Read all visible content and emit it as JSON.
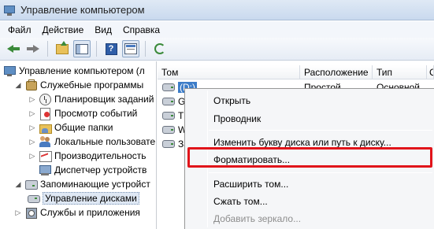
{
  "window": {
    "title": "Управление компьютером"
  },
  "menubar": {
    "items": [
      "Файл",
      "Действие",
      "Вид",
      "Справка"
    ]
  },
  "toolbar": {
    "buttons": [
      "back-icon",
      "forward-icon",
      "up-folder-icon",
      "show-hide-tree-icon",
      "help-icon",
      "properties-icon",
      "refresh-icon"
    ],
    "help_glyph": "?"
  },
  "tree": {
    "root": "Управление компьютером (л",
    "system_tools": "Служебные программы",
    "task_scheduler": "Планировщик заданий",
    "event_viewer": "Просмотр событий",
    "shared_folders": "Общие папки",
    "local_users": "Локальные пользовате",
    "performance": "Производительность",
    "device_manager": "Диспетчер устройств",
    "storage": "Запоминающие устройст",
    "disk_management": "Управление дисками",
    "services_apps": "Службы и приложения"
  },
  "columns": [
    "Том",
    "Расположение",
    "Тип",
    "С"
  ],
  "volumes": [
    {
      "name": "(D:)",
      "layout": "Простой",
      "type": "Основной",
      "status": ""
    },
    {
      "name": "Ga",
      "layout": "",
      "type": "",
      "status": ""
    },
    {
      "name": "TC",
      "layout": "",
      "type": "",
      "status": ""
    },
    {
      "name": "Wi",
      "layout": "",
      "type": "",
      "status": ""
    },
    {
      "name": "За",
      "layout": "",
      "type": "",
      "status": ""
    }
  ],
  "context_menu": {
    "open": "Открыть",
    "explore": "Проводник",
    "change_letter": "Изменить букву диска или путь к диску...",
    "format": "Форматировать...",
    "extend": "Расширить том...",
    "shrink": "Сжать том...",
    "add_mirror": "Добавить зеркало..."
  },
  "colors": {
    "highlight_border": "#e1141a",
    "selection": "#3d7dc8"
  }
}
